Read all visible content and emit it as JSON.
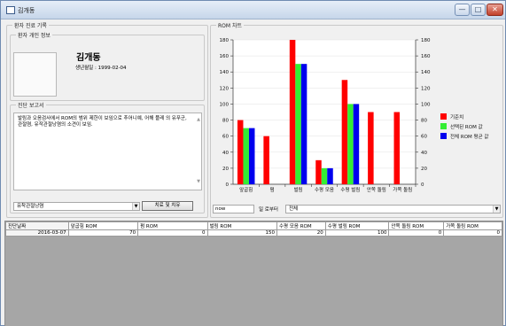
{
  "window": {
    "title": "김개동",
    "minimize_glyph": "—",
    "maximize_glyph": "□",
    "close_glyph": "✕"
  },
  "record_group": {
    "label": "환자 진료 기록",
    "info_label": "환자 개인 정보",
    "patient_name": "김개동",
    "birth_date": "생년월일 : 1999-02-04"
  },
  "report_group": {
    "label": "진단 보고서",
    "text": "발림과 오음검사에서 ROM의 범위 제한이 보임으로 추어니예, 어해 플레 의 유푸군, 관절염, 유작관절낭염의 소견이 보임.",
    "diagnosis_selected": "유착관절낭염",
    "treat_button": "치료 및 치유"
  },
  "chart_panel": {
    "label": "ROM 차트",
    "date_input": "now",
    "date_suffix": "일 로부터",
    "range_selected": "전체"
  },
  "chart_data": {
    "type": "bar",
    "categories": [
      "앞굽힘",
      "펌",
      "벌림",
      "수평 모음",
      "수평 벌림",
      "안쪽 돌림",
      "가쪽 돌림"
    ],
    "series": [
      {
        "name": "기준치",
        "color": "#ff0000",
        "values": [
          80,
          60,
          180,
          30,
          130,
          90,
          90
        ]
      },
      {
        "name": "선택된 ROM 값",
        "color": "#33ee33",
        "values": [
          70,
          0,
          150,
          20,
          100,
          0,
          0
        ]
      },
      {
        "name": "전체 ROM 평균 값",
        "color": "#0000ee",
        "values": [
          70,
          0,
          150,
          20,
          100,
          0,
          0
        ]
      }
    ],
    "ylim": [
      0,
      180
    ],
    "yticks": [
      0,
      20,
      40,
      60,
      80,
      100,
      120,
      140,
      160,
      180
    ],
    "legend_position": "right"
  },
  "table": {
    "columns": [
      "진단날짜",
      "앞굽힘 ROM",
      "펌 ROM",
      "벌림 ROM",
      "수평 모음 ROM",
      "수평 벌림 ROM",
      "안쪽 돌림 ROM",
      "가쪽 돌림 ROM"
    ],
    "rows": [
      [
        "2016-03-07",
        "70",
        "0",
        "150",
        "20",
        "100",
        "0",
        "0"
      ]
    ]
  }
}
